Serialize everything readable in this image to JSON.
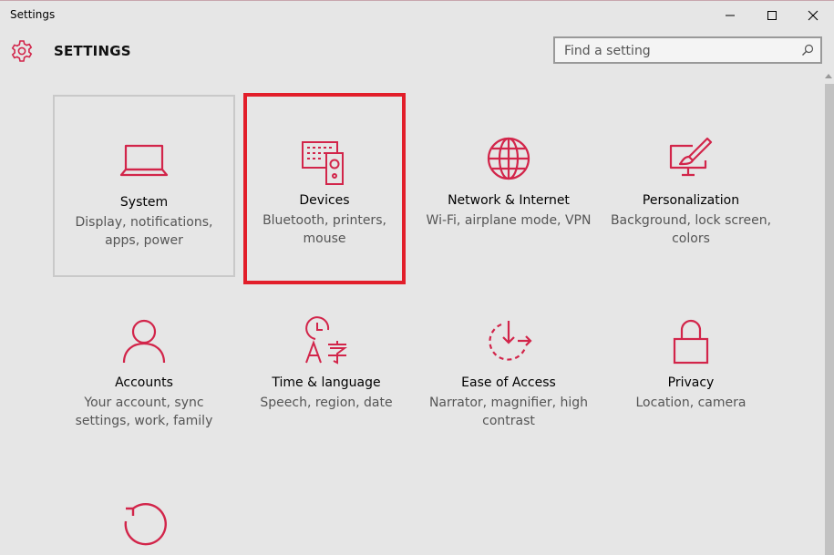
{
  "window": {
    "title": "Settings",
    "controls": [
      "minimize",
      "maximize",
      "close"
    ]
  },
  "header": {
    "title": "SETTINGS",
    "search_placeholder": "Find a setting"
  },
  "colors": {
    "accent": "#d2254a",
    "highlight_border": "#e21e2a",
    "background": "#e6e6e6"
  },
  "tiles": [
    {
      "name": "System",
      "desc": "Display, notifications, apps, power",
      "icon": "laptop-icon"
    },
    {
      "name": "Devices",
      "desc": "Bluetooth, printers, mouse",
      "icon": "devices-icon"
    },
    {
      "name": "Network & Internet",
      "desc": "Wi-Fi, airplane mode, VPN",
      "icon": "globe-icon"
    },
    {
      "name": "Personalization",
      "desc": "Background, lock screen, colors",
      "icon": "paint-brush-icon"
    },
    {
      "name": "Accounts",
      "desc": "Your account, sync settings, work, family",
      "icon": "person-icon"
    },
    {
      "name": "Time & language",
      "desc": "Speech, region, date",
      "icon": "clock-language-icon"
    },
    {
      "name": "Ease of Access",
      "desc": "Narrator, magnifier, high contrast",
      "icon": "ease-of-access-icon"
    },
    {
      "name": "Privacy",
      "desc": "Location, camera",
      "icon": "lock-icon"
    },
    {
      "name": "",
      "desc": "",
      "icon": "update-icon"
    }
  ]
}
